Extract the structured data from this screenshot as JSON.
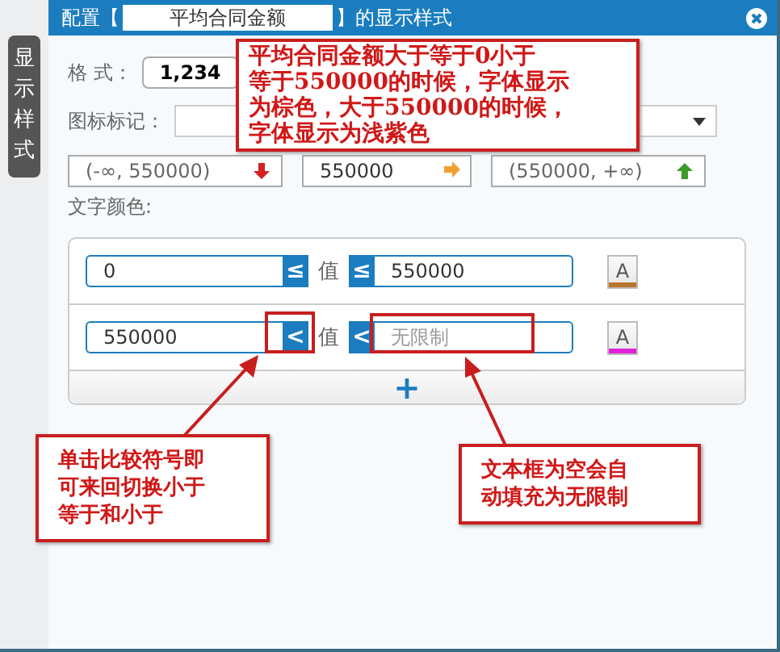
{
  "side_tab": {
    "label": "显示样式",
    "selected": true
  },
  "title": {
    "prefix": "配置【",
    "field_value": "平均合同金额",
    "suffix": "】的显示样式"
  },
  "format": {
    "label": "格 式：",
    "button": "1,234"
  },
  "icon_mark": {
    "label": "图标标记："
  },
  "ranges": [
    {
      "text": "(-∞, 550000)",
      "kind": "down"
    },
    {
      "text": "550000",
      "kind": "right"
    },
    {
      "text": "(550000, +∞)",
      "kind": "up"
    }
  ],
  "text_color": {
    "label": "文字颜色:",
    "rules": [
      {
        "min": "0",
        "min_op": "≤",
        "value_label": "值",
        "max_op": "≤",
        "max": "550000",
        "swatch_label": "A",
        "color": "#b8742a"
      },
      {
        "min": "550000",
        "min_op": "<",
        "value_label": "值",
        "max_op": "<",
        "placeholder": "无限制",
        "swatch_label": "A",
        "color": "#e020d8"
      }
    ],
    "add_button": "+"
  },
  "callouts": [
    {
      "lines": [
        "平均合同金额大于等于0小于",
        "等于550000的时候，字体显示",
        "为棕色，大于550000的时候，",
        "字体显示为浅紫色"
      ]
    },
    {
      "lines": [
        "单击比较符号即",
        "可来回切换小于",
        "等于和小于"
      ]
    },
    {
      "lines": [
        "文本框为空会自",
        "动填充为无限制"
      ]
    }
  ]
}
